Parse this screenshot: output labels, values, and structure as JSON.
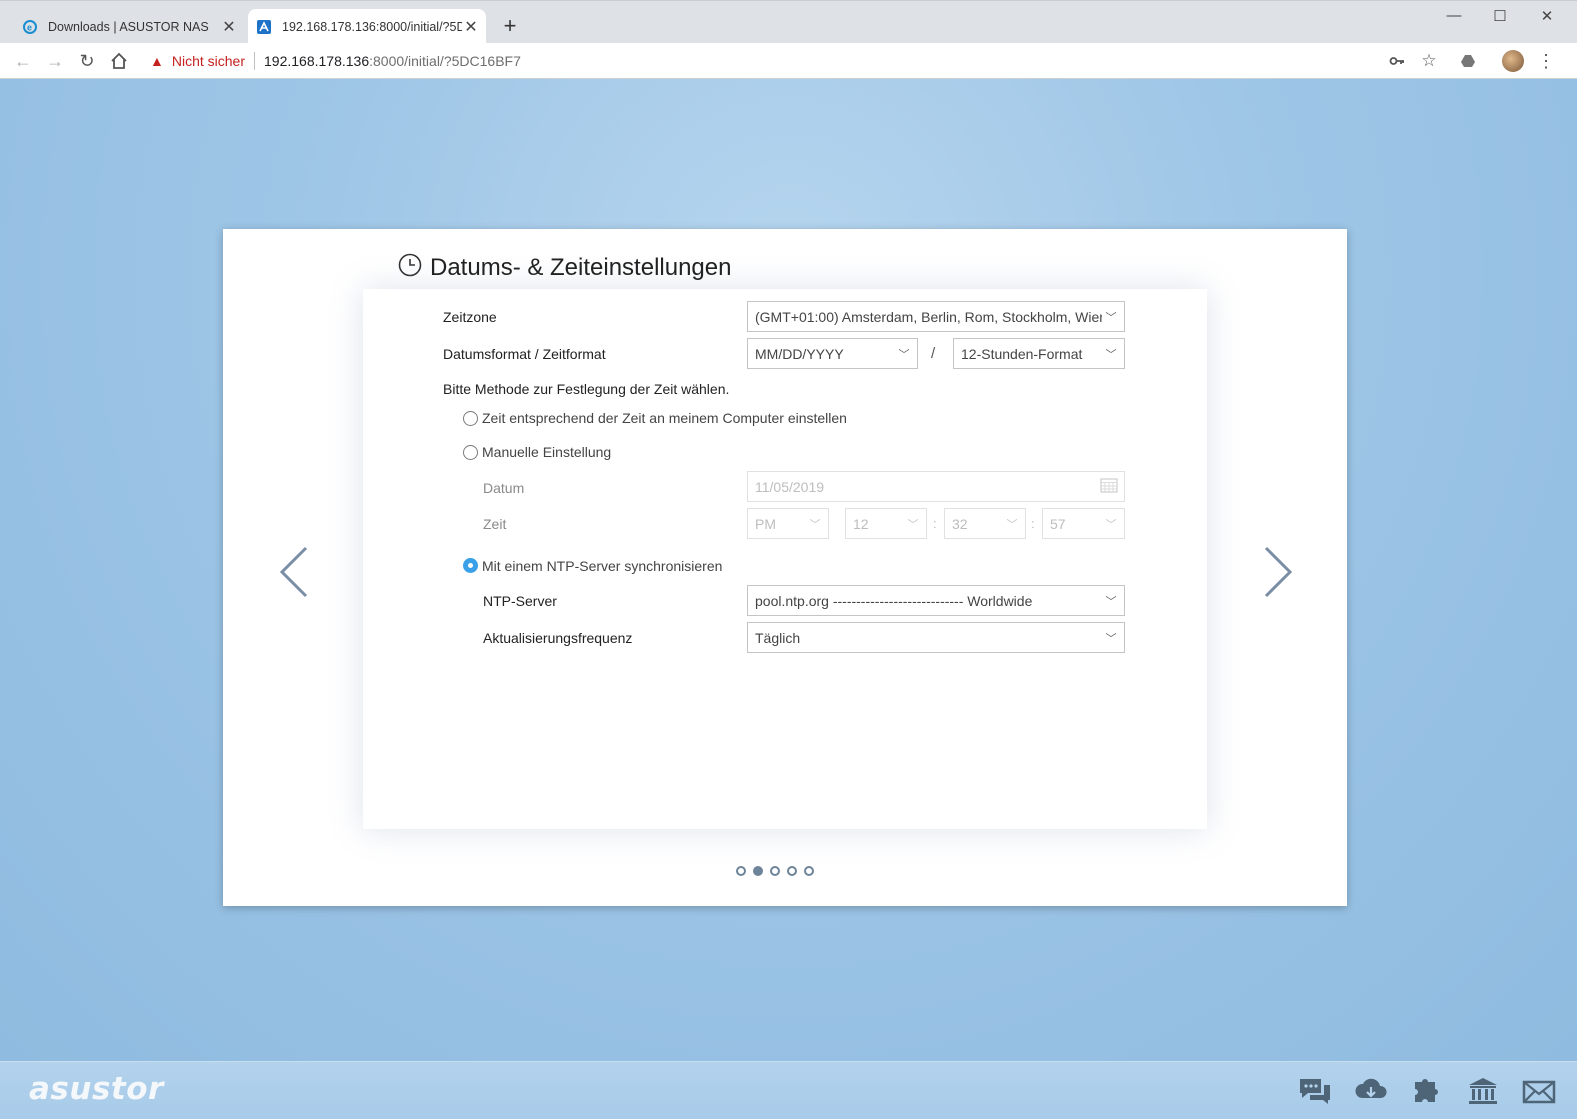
{
  "browser": {
    "tabs": [
      {
        "label": "Downloads | ASUSTOR NAS",
        "active": false
      },
      {
        "label": "192.168.178.136:8000/initial/?5DC16BF7",
        "active": true
      }
    ],
    "security_label": "Nicht sicher",
    "url_host": "192.168.178.136",
    "url_rest": ":8000/initial/?5DC16BF7"
  },
  "wizard": {
    "title": "Datums- & Zeiteinstellungen",
    "timezone": {
      "label": "Zeitzone",
      "value": "(GMT+01:00) Amsterdam, Berlin, Rom, Stockholm, Wien"
    },
    "format": {
      "label": "Datumsformat / Zeitformat",
      "date_value": "MM/DD/YYYY",
      "separator": "/",
      "time_value": "12-Stunden-Format"
    },
    "method_prompt": "Bitte Methode zur Festlegung der Zeit wählen.",
    "options": {
      "computer": "Zeit entsprechend der Zeit an meinem Computer einstellen",
      "manual": "Manuelle Einstellung",
      "ntp": "Mit einem NTP-Server synchronisieren"
    },
    "selected_option": "ntp",
    "manual": {
      "date_label": "Datum",
      "date_value": "11/05/2019",
      "time_label": "Zeit",
      "ampm": "PM",
      "hour": "12",
      "minute": "32",
      "second": "57",
      "colon": ":"
    },
    "ntp": {
      "server_label": "NTP-Server",
      "server_value": "pool.ntp.org ---------------------------- Worldwide",
      "freq_label": "Aktualisierungsfrequenz",
      "freq_value": "Täglich"
    },
    "pager": {
      "total": 5,
      "current": 2
    }
  },
  "footer": {
    "logo": "asustor",
    "icons": [
      "chat-icon",
      "cloud-download-icon",
      "puzzle-icon",
      "bank-icon",
      "mail-icon"
    ]
  }
}
